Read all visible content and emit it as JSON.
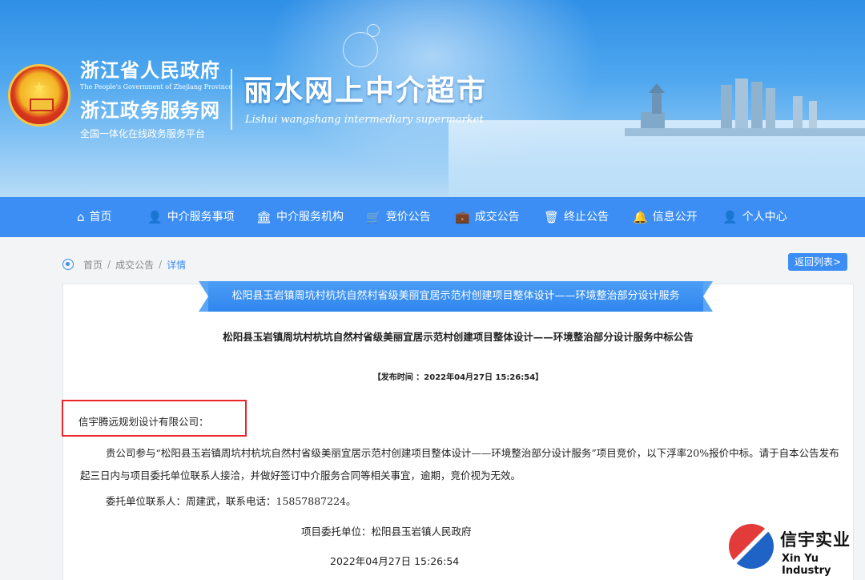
{
  "banner": {
    "gov_title": "浙江省人民政府",
    "gov_en": "The People's Government of Zhejiang Province",
    "gov_sub": "浙江政务服务网",
    "gov_slogan": "全国一体化在线政务服务平台",
    "market_title": "丽水网上中介超市",
    "market_en": "Lishui wangshang intermediary supermarket"
  },
  "nav": {
    "items": [
      {
        "label": "首页",
        "icon": "home-icon",
        "glyph": "⌂"
      },
      {
        "label": "中介服务事项",
        "icon": "user-icon",
        "glyph": "👤"
      },
      {
        "label": "中介服务机构",
        "icon": "institution-icon",
        "glyph": "🏛"
      },
      {
        "label": "竞价公告",
        "icon": "cart-icon",
        "glyph": "🛒"
      },
      {
        "label": "成交公告",
        "icon": "briefcase-icon",
        "glyph": "💼"
      },
      {
        "label": "终止公告",
        "icon": "trash-icon",
        "glyph": "🗑"
      },
      {
        "label": "信息公开",
        "icon": "bell-icon",
        "glyph": "🔔"
      },
      {
        "label": "个人中心",
        "icon": "person-icon",
        "glyph": "👤"
      }
    ]
  },
  "breadcrumb": {
    "items": [
      "首页",
      "成交公告",
      "详情"
    ],
    "back_label": "返回列表>"
  },
  "notice": {
    "ribbon_title": "松阳县玉岩镇周坑村杭坑自然村省级美丽宜居示范村创建项目整体设计——环境整治部分设计服务",
    "doc_title": "松阳县玉岩镇周坑村杭坑自然村省级美丽宜居示范村创建项目整体设计——环境整治部分设计服务中标公告",
    "publish_time": "【发布时间 ：2022年04月27日 15:26:54】",
    "recipient": "信宇腾远规划设计有限公司：",
    "body": "贵公司参与“松阳县玉岩镇周坑村杭坑自然村省级美丽宜居示范村创建项目整体设计——环境整治部分设计服务”项目竞价，以下浮率20%报价中标。请于自本公告发布起三日内与项目委托单位联系人接洽，并做好签订中介服务合同等相关事宜，逾期，竞价视为无效。",
    "contact": "委托单位联系人：周建武，联系电话：15857887224。",
    "entrust": "项目委托单位：松阳县玉岩镇人民政府",
    "sign_date": "2022年04月27日 15:26:54"
  },
  "watermark": {
    "name_zh": "信宇实业",
    "name_en": "Xin Yu Industry"
  },
  "colors": {
    "nav": "#3c8ef4",
    "highlight": "#e8262c"
  }
}
